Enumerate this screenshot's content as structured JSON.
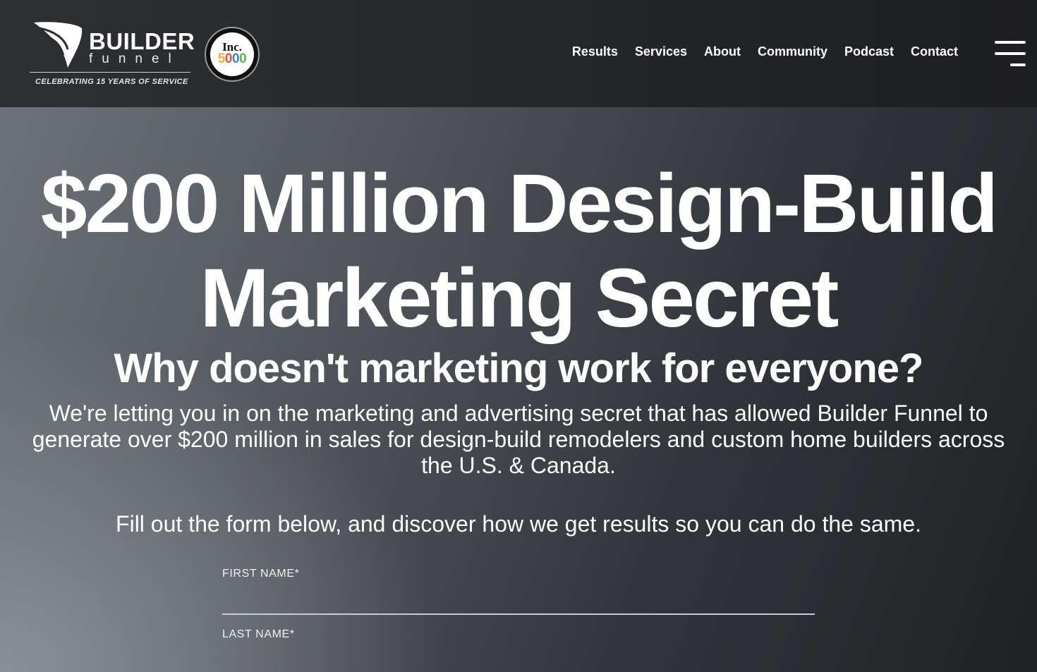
{
  "header": {
    "logo": {
      "wordmark": "BUILDER",
      "sub": "funnel",
      "tagline": "CELEBRATING 15 YEARS OF SERVICE"
    },
    "badge": {
      "top": "Inc.",
      "number": "5000",
      "number_colors": [
        "#f2a93b",
        "#e0533d",
        "#3f7fd6",
        "#5ab552"
      ]
    },
    "nav": [
      {
        "label": "Results"
      },
      {
        "label": "Services"
      },
      {
        "label": "About"
      },
      {
        "label": "Community"
      },
      {
        "label": "Podcast"
      },
      {
        "label": "Contact"
      }
    ],
    "menu_icon": "hamburger-menu-icon"
  },
  "hero": {
    "headline": "$200 Million Design-Build Marketing Secret",
    "subheadline": "Why doesn't marketing work for everyone?",
    "lead": "We're letting you in on the marketing and advertising secret that has allowed Builder Funnel to generate over $200 million in sales for design-build remodelers and custom home builders across the U.S. & Canada.",
    "cta": "Fill out the form below, and discover how we get results so you can do the same."
  },
  "form": {
    "first_name": {
      "label": "FIRST NAME*",
      "value": ""
    },
    "last_name": {
      "label": "LAST NAME*",
      "value": ""
    }
  }
}
